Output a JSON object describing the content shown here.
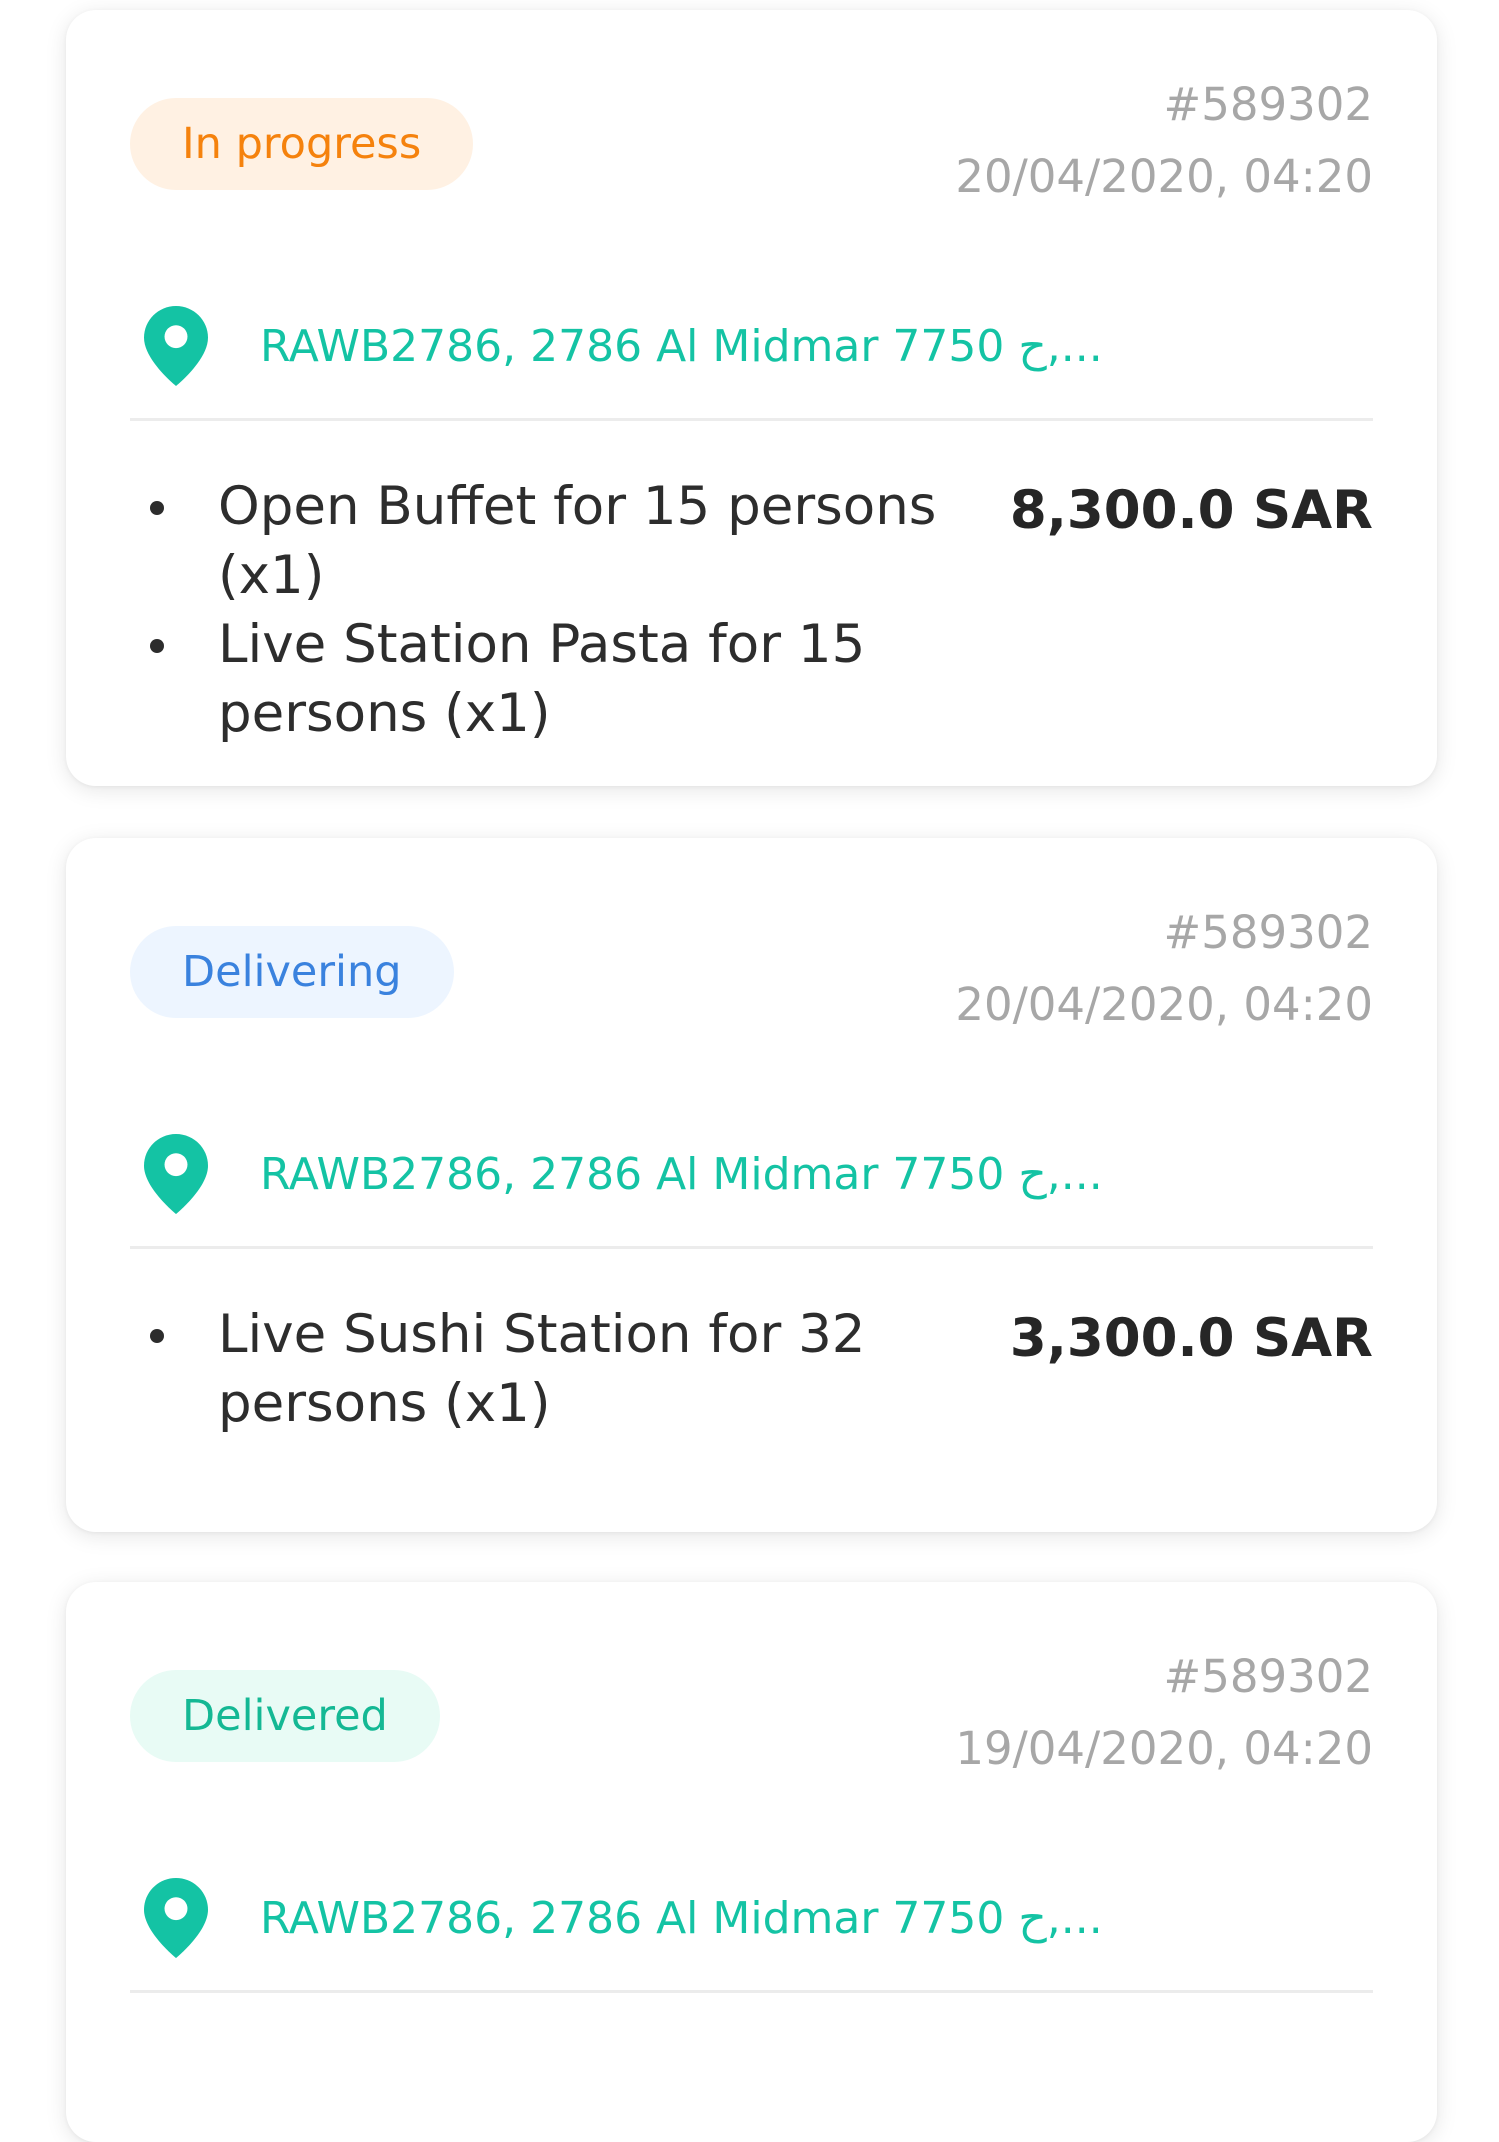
{
  "orders": [
    {
      "status": "In progress",
      "status_color": "#f5820d",
      "status_bg": "#fff1e3",
      "order_id": "#589302",
      "date": "20/04/2020, 04:20",
      "address": "RAWB2786, 2786 Al Midmar 7750 ح,...",
      "items": [
        "Open Buffet for 15 persons (x1)",
        "Live Station Pasta for 15 persons (x1)"
      ],
      "price": "8,300.0 SAR"
    },
    {
      "status": "Delivering",
      "status_color": "#3a82de",
      "status_bg": "#edf5ff",
      "order_id": "#589302",
      "date": "20/04/2020, 04:20",
      "address": "RAWB2786, 2786 Al Midmar 7750 ح,...",
      "items": [
        "Live Sushi Station for 32 persons (x1)"
      ],
      "price": "3,300.0 SAR"
    },
    {
      "status": "Delivered",
      "status_color": "#14b894",
      "status_bg": "#e8fbf5",
      "order_id": "#589302",
      "date": "19/04/2020, 04:20",
      "address": "RAWB2786, 2786 Al Midmar 7750 ح,...",
      "items": [],
      "price": ""
    }
  ],
  "icons": {
    "location": "map-pin-icon"
  },
  "colors": {
    "accent": "#14c3a4",
    "muted_text": "#a7a7a7",
    "body_text": "#2d2d2d"
  }
}
